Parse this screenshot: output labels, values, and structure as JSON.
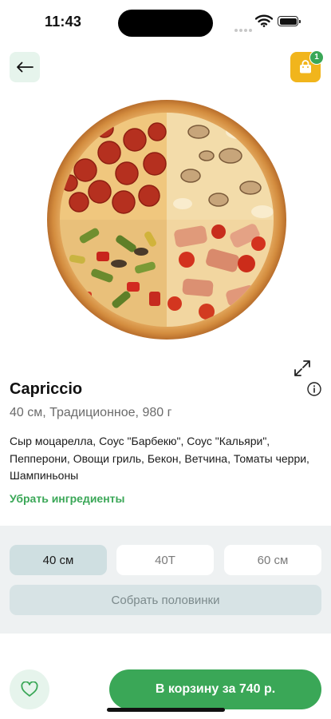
{
  "status_bar": {
    "time": "11:43"
  },
  "product": {
    "title": "Capriccio",
    "subtitle": "40 см, Традиционное, 980 г",
    "ingredients": "Сыр моцарелла, Соус \"Барбекю\", Соус \"Кальяри\", Пепперони, Овощи гриль, Бекон, Ветчина, Томаты черри, Шампиньоны",
    "remove_ingredients_label": "Убрать ингредиенты"
  },
  "header": {
    "cart_count": "1"
  },
  "sizes": {
    "options": [
      "40 см",
      "40T",
      "60 см"
    ],
    "selected": "40 см"
  },
  "halves_label": "Собрать половинки",
  "add_to_cart_label": "В корзину за 740 р.",
  "icons": {
    "back": "arrow-left-icon",
    "cart": "shopping-bag-icon",
    "expand": "expand-icon",
    "info": "info-icon",
    "favorite": "heart-icon"
  },
  "colors": {
    "accent_green": "#3aa757",
    "cart_yellow": "#f1b51c",
    "light_green_bg": "#e6f4ec",
    "panel_bg": "#eef1f2",
    "selected_size_bg": "#cfdfe1"
  }
}
